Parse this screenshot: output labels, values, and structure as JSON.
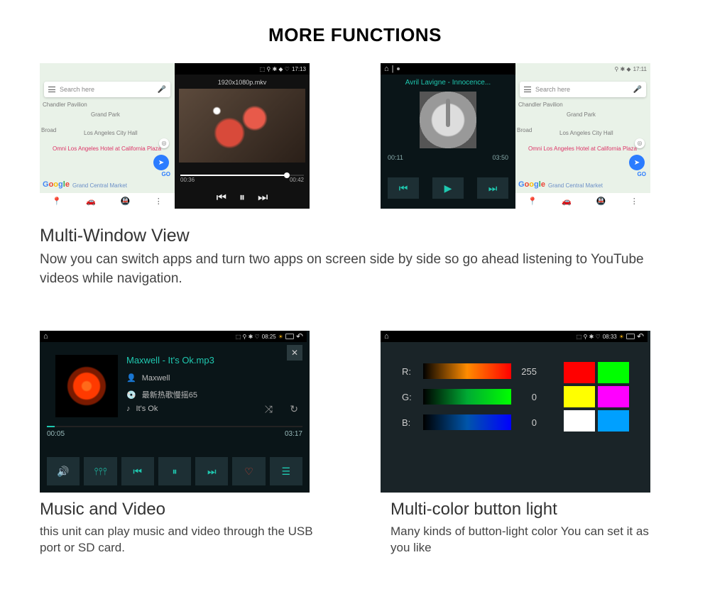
{
  "page_title": "MORE FUNCTIONS",
  "section1": {
    "heading": "Multi-Window View",
    "body": "Now you can switch apps and turn two apps on screen side by side so go ahead listening to YouTube videos while navigation."
  },
  "section2": {
    "heading": "Music and Video",
    "body": "this unit can play music and video through the USB port or SD card."
  },
  "section3": {
    "heading": "Multi-color button light",
    "body": "Many kinds of button-light color You can set it as you like"
  },
  "ss1": {
    "status_time": "17:13",
    "video_name": "1920x1080p.mkv",
    "time_cur": "00:36",
    "time_dur": "00:42",
    "map": {
      "search_placeholder": "Search here",
      "poi1": "Chandler Pavilion",
      "poi2": "Grand Park",
      "poi3": "Los Angeles City Hall",
      "poi4": "Broad",
      "poi5": "Omni Los Angeles Hotel at California Plaza",
      "poi6": "Grand Central Market",
      "go": "GO"
    }
  },
  "ss2": {
    "status_time": "17:11",
    "track": "Avril Lavigne - Innocence...",
    "time_cur": "00:11",
    "time_dur": "03:50",
    "map": {
      "search_placeholder": "Search here",
      "poi1": "Chandler Pavilion",
      "poi2": "Grand Park",
      "poi3": "Los Angeles City Hall",
      "poi4": "Broad",
      "poi5": "Omni Los Angeles Hotel at California Plaza",
      "poi6": "Grand Central Market",
      "go": "GO"
    }
  },
  "ss3": {
    "status_time": "08:25",
    "track": "Maxwell - It's Ok.mp3",
    "artist": "Maxwell",
    "album": "最新热歌慢摇65",
    "song": "It's Ok",
    "time_cur": "00:05",
    "time_dur": "03:17"
  },
  "ss4": {
    "status_time": "08:33",
    "r_label": "R:",
    "r_val": "255",
    "g_label": "G:",
    "g_val": "0",
    "b_label": "B:",
    "b_val": "0",
    "swatches": [
      "#ff0000",
      "#00ff00",
      "#ffff00",
      "#ff00ff",
      "#ffffff",
      "#00a0ff"
    ]
  }
}
